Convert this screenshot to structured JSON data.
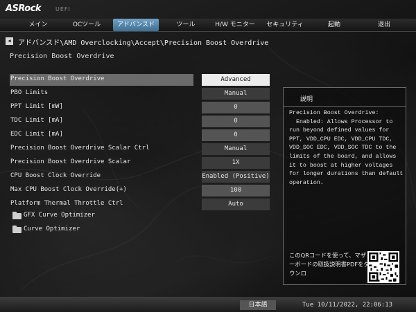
{
  "header": {
    "logo": "ASRock",
    "uefi": "UEFI",
    "menu": [
      {
        "label": "メイン",
        "active": false
      },
      {
        "label": "OCツール",
        "active": false
      },
      {
        "label": "アドバンスド",
        "active": true
      },
      {
        "label": "ツール",
        "active": false
      },
      {
        "label": "H/W モニター",
        "active": false
      },
      {
        "label": "セキュリティ",
        "active": false
      },
      {
        "label": "起動",
        "active": false
      },
      {
        "label": "退出",
        "active": false
      }
    ]
  },
  "breadcrumb": "アドバンスド\\AMD Overclocking\\Accept\\Precision Boost Overdrive",
  "page_title": "Precision Boost Overdrive",
  "settings": [
    {
      "label": "Precision Boost Overdrive",
      "value": "Advanced"
    },
    {
      "label": "PBO Limits",
      "value": "Manual"
    },
    {
      "label": "PPT Limit [mW]",
      "value": "0"
    },
    {
      "label": "TDC Limit [mA]",
      "value": "0"
    },
    {
      "label": "EDC Limit [mA]",
      "value": "0"
    },
    {
      "label": "Precision Boost Overdrive Scalar Ctrl",
      "value": "Manual"
    },
    {
      "label": "Precision Boost Overdrive Scalar",
      "value": "1X"
    },
    {
      "label": "CPU Boost Clock Override",
      "value": "Enabled (Positive)"
    },
    {
      "label": "Max CPU Boost Clock Override(+)",
      "value": "100"
    },
    {
      "label": "Platform Thermal Throttle Ctrl",
      "value": "Auto"
    }
  ],
  "submenus": [
    {
      "label": "GFX Curve Optimizer",
      "icon": "folder-icon"
    },
    {
      "label": "Curve Optimizer",
      "icon": "folder-icon"
    }
  ],
  "description": {
    "title": "説明",
    "text": "Precision Boost Overdrive:\n  Enabled: Allows Processor to run beyond defined values for PPT, VDD_CPU EDC, VDD_CPU TDC, VDD_SOC EDC, VDD_SOC TDC to the limits of the board, and allows it to boost at higher voltages for longer durations than default operation.",
    "qr_text": "このQRコードを使って、マザーボードの取扱説明書PDFをダウンロ"
  },
  "footer": {
    "language": "日本語",
    "datetime": "Tue 10/11/2022, 22:06:13"
  }
}
